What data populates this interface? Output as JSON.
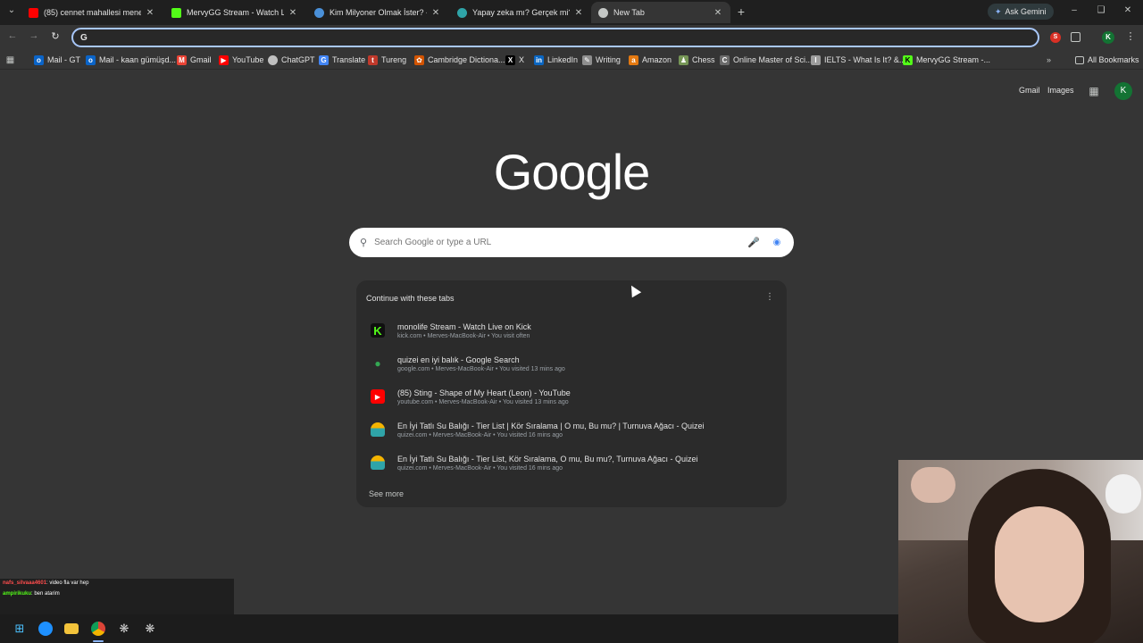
{
  "browser": {
    "tabs": [
      {
        "title": "(85) cennet mahallesi meneks",
        "favicon": "youtube-icon",
        "color": "#ff0000",
        "active": false
      },
      {
        "title": "MervyGG Stream - Watch Live o",
        "favicon": "kick-icon",
        "color": "#53fc18",
        "active": false
      },
      {
        "title": "Kim Milyoner Olmak İster? - Tr",
        "favicon": "site-icon",
        "color": "#4a90d9",
        "active": false
      },
      {
        "title": "Yapay zeka mı? Gerçek mi? - Q",
        "favicon": "quizei-icon",
        "color": "#2fa4a8",
        "active": false
      },
      {
        "title": "New Tab",
        "favicon": "chrome-icon",
        "color": "#c4c7c5",
        "active": true
      }
    ],
    "ask_gemini": "Ask Gemini",
    "omnibox": {
      "value": "",
      "placeholder": ""
    },
    "bookmarks": [
      {
        "label": "Mail - GT",
        "icon": "outlook-icon",
        "color": "#0a64c8"
      },
      {
        "label": "Mail - kaan gümüşd...",
        "icon": "outlook-icon",
        "color": "#0a64c8"
      },
      {
        "label": "Gmail",
        "icon": "gmail-icon",
        "color": "#ea4335"
      },
      {
        "label": "YouTube",
        "icon": "youtube-icon",
        "color": "#ff0000"
      },
      {
        "label": "ChatGPT",
        "icon": "chatgpt-icon",
        "color": "#bfbfbf"
      },
      {
        "label": "Translate",
        "icon": "translate-icon",
        "color": "#4285f4"
      },
      {
        "label": "Tureng",
        "icon": "tureng-icon",
        "color": "#c0392b"
      },
      {
        "label": "Cambridge Dictiona...",
        "icon": "cambridge-icon",
        "color": "#d35400"
      },
      {
        "label": "X",
        "icon": "x-icon",
        "color": "#000000"
      },
      {
        "label": "LinkedIn",
        "icon": "linkedin-icon",
        "color": "#0a66c2"
      },
      {
        "label": "Writing",
        "icon": "writing-icon",
        "color": "#8e8e8e"
      },
      {
        "label": "Amazon",
        "icon": "amazon-icon",
        "color": "#e47911"
      },
      {
        "label": "Chess",
        "icon": "chess-icon",
        "color": "#769656"
      },
      {
        "label": "Online Master of Sci...",
        "icon": "coursera-icon",
        "color": "#6b6b6b"
      },
      {
        "label": "IELTS - What Is It? &...",
        "icon": "ielts-icon",
        "color": "#9c9c9c"
      },
      {
        "label": "MervyGG Stream -...",
        "icon": "kick-icon",
        "color": "#53fc18"
      }
    ],
    "all_bookmarks": "All Bookmarks"
  },
  "newtab": {
    "gmail": "Gmail",
    "images": "Images",
    "avatar_letter": "K",
    "logo": "Google",
    "search_placeholder": "Search Google or type a URL",
    "continue_title": "Continue with these tabs",
    "tabs": [
      {
        "title": "monolife Stream - Watch Live on Kick",
        "meta": "kick.com • Merves-MacBook-Air • You visit often",
        "icon": "kick-icon",
        "color": "#53fc18"
      },
      {
        "title": "quizei en iyi balık - Google Search",
        "meta": "google.com • Merves-MacBook-Air • You visited 13 mins ago",
        "icon": "google-maps-icon",
        "color": "#34a853"
      },
      {
        "title": "(85) Sting - Shape of My Heart (Leon) - YouTube",
        "meta": "youtube.com • Merves-MacBook-Air • You visited 13 mins ago",
        "icon": "youtube-icon",
        "color": "#ff0000"
      },
      {
        "title": "En İyi Tatlı Su Balığı - Tier List | Kör Sıralama | O mu, Bu mu? | Turnuva Ağacı - Quizei",
        "meta": "quizei.com • Merves-MacBook-Air • You visited 16 mins ago",
        "icon": "quizei-icon",
        "color": "#2fa4a8"
      },
      {
        "title": "En İyi Tatlı Su Balığı - Tier List, Kör Sıralama, O mu, Bu mu?, Turnuva Ağacı - Quizei",
        "meta": "quizei.com • Merves-MacBook-Air • You visited 16 mins ago",
        "icon": "quizei-icon",
        "color": "#2fa4a8"
      }
    ],
    "see_more": "See more"
  },
  "chat": [
    {
      "user": "nafs_silvaaa4601",
      "message": ": video fla var hep",
      "color": "#ff4d4d"
    },
    {
      "user": "ampirikuku",
      "message": ": ben atarim",
      "color": "#53fc18"
    }
  ],
  "taskbar": [
    {
      "name": "windows-start-icon",
      "color": "#4cc2ff"
    },
    {
      "name": "edge-icon",
      "color": "#1e90ff"
    },
    {
      "name": "file-explorer-icon",
      "color": "#f3c33b"
    },
    {
      "name": "chrome-icon",
      "color": "#db4437"
    },
    {
      "name": "chatgpt-icon",
      "color": "#d0d0d0"
    },
    {
      "name": "app-icon",
      "color": "#d0d0d0"
    }
  ]
}
